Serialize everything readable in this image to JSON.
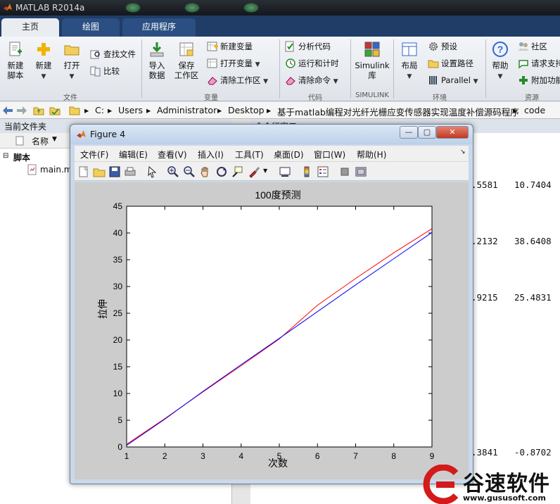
{
  "app": {
    "title": "MATLAB R2014a"
  },
  "tabs": [
    {
      "label": "主页",
      "active": true
    },
    {
      "label": "绘图",
      "active": false
    },
    {
      "label": "应用程序",
      "active": false
    }
  ],
  "ribbon": {
    "new_script": "新建\n脚本",
    "new": "新建",
    "open": "打开",
    "find_files": "查找文件",
    "compare": "比较",
    "import_data": "导入\n数据",
    "save_workspace": "保存\n工作区",
    "new_variable": "新建变量",
    "open_variable": "打开变量",
    "clear_workspace": "清除工作区",
    "analyze_code": "分析代码",
    "run_and_time": "运行和计时",
    "clear_commands": "清除命令",
    "simulink_library": "Simulink\n库",
    "layout": "布局",
    "preferences": "预设",
    "set_path": "设置路径",
    "parallel": "Parallel",
    "help": "帮助",
    "community": "社区",
    "request_support": "请求支持",
    "addons": "附加功能",
    "groups": [
      "文件",
      "变量",
      "代码",
      "SIMULINK",
      "环境",
      "资源"
    ]
  },
  "address": {
    "segments": [
      "C:",
      "Users",
      "Administrator",
      "Desktop",
      "基于matlab编程对光纤光栅应变传感器实现温度补偿源码程序",
      "code"
    ]
  },
  "left_panel": {
    "title": "当前文件夹",
    "column_name": "名称",
    "group": "脚本",
    "file": "main.m"
  },
  "command_window": {
    "title": "命令行窗口",
    "values": [
      {
        "a": ".5581",
        "b": "10.7404"
      },
      {
        "a": ".2132",
        "b": "38.6408"
      },
      {
        "a": ".9215",
        "b": "25.4831"
      },
      {
        "a": ".3841",
        "b": "-0.8702"
      }
    ]
  },
  "figure": {
    "title": "Figure 4",
    "menu": [
      "文件(F)",
      "编辑(E)",
      "查看(V)",
      "插入(I)",
      "工具(T)",
      "桌面(D)",
      "窗口(W)",
      "帮助(H)"
    ],
    "window_buttons": {
      "minimize": "—",
      "maximize": "▢",
      "close": "✕"
    }
  },
  "watermark": {
    "text": "谷速软件",
    "url": "www.gususoft.com"
  },
  "colors": {
    "ribbon_tabbar": "#1f3d66",
    "series_red": "#ff0000",
    "series_blue": "#0000ff"
  },
  "chart_data": {
    "type": "line",
    "title": "100度预测",
    "xlabel": "次数",
    "ylabel": "拉伸",
    "xlim": [
      1,
      9
    ],
    "ylim": [
      0,
      45
    ],
    "xticks": [
      1,
      2,
      3,
      4,
      5,
      6,
      7,
      8,
      9
    ],
    "yticks": [
      0,
      5,
      10,
      15,
      20,
      25,
      30,
      35,
      40,
      45
    ],
    "grid": false,
    "series": [
      {
        "color": "#ff0000",
        "x": [
          1,
          2,
          3,
          4,
          5,
          6,
          7,
          8,
          9
        ],
        "y": [
          0.5,
          5.3,
          10.3,
          15.2,
          20.2,
          26.5,
          31.5,
          36.3,
          40.8
        ]
      },
      {
        "color": "#0000ff",
        "x": [
          1,
          2,
          3,
          4,
          5,
          6,
          7,
          8,
          9
        ],
        "y": [
          0.3,
          5.2,
          10.4,
          15.4,
          20.3,
          25.3,
          30.3,
          35.2,
          40.1
        ]
      }
    ]
  }
}
